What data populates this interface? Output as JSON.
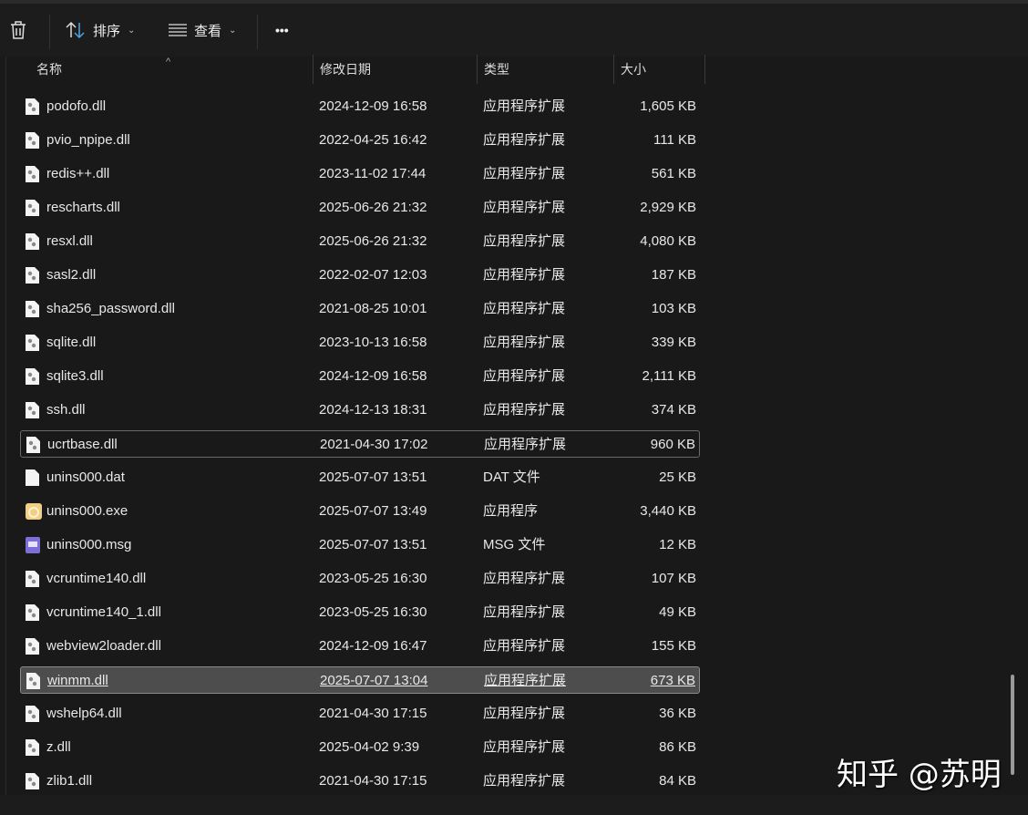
{
  "toolbar": {
    "sort_label": "排序",
    "view_label": "查看",
    "more_label": "•••"
  },
  "columns": {
    "name": "名称",
    "date": "修改日期",
    "type": "类型",
    "size": "大小"
  },
  "files": [
    {
      "name": "podofo.dll",
      "date": "2024-12-09 16:58",
      "type": "应用程序扩展",
      "size": "1,605 KB",
      "icon": "dll"
    },
    {
      "name": "pvio_npipe.dll",
      "date": "2022-04-25 16:42",
      "type": "应用程序扩展",
      "size": "111 KB",
      "icon": "dll"
    },
    {
      "name": "redis++.dll",
      "date": "2023-11-02 17:44",
      "type": "应用程序扩展",
      "size": "561 KB",
      "icon": "dll"
    },
    {
      "name": "rescharts.dll",
      "date": "2025-06-26 21:32",
      "type": "应用程序扩展",
      "size": "2,929 KB",
      "icon": "dll"
    },
    {
      "name": "resxl.dll",
      "date": "2025-06-26 21:32",
      "type": "应用程序扩展",
      "size": "4,080 KB",
      "icon": "dll"
    },
    {
      "name": "sasl2.dll",
      "date": "2022-02-07 12:03",
      "type": "应用程序扩展",
      "size": "187 KB",
      "icon": "dll"
    },
    {
      "name": "sha256_password.dll",
      "date": "2021-08-25 10:01",
      "type": "应用程序扩展",
      "size": "103 KB",
      "icon": "dll"
    },
    {
      "name": "sqlite.dll",
      "date": "2023-10-13 16:58",
      "type": "应用程序扩展",
      "size": "339 KB",
      "icon": "dll"
    },
    {
      "name": "sqlite3.dll",
      "date": "2024-12-09 16:58",
      "type": "应用程序扩展",
      "size": "2,111 KB",
      "icon": "dll"
    },
    {
      "name": "ssh.dll",
      "date": "2024-12-13 18:31",
      "type": "应用程序扩展",
      "size": "374 KB",
      "icon": "dll"
    },
    {
      "name": "ucrtbase.dll",
      "date": "2021-04-30 17:02",
      "type": "应用程序扩展",
      "size": "960 KB",
      "icon": "dll",
      "state": "focus"
    },
    {
      "name": "unins000.dat",
      "date": "2025-07-07 13:51",
      "type": "DAT 文件",
      "size": "25 KB",
      "icon": "dat"
    },
    {
      "name": "unins000.exe",
      "date": "2025-07-07 13:49",
      "type": "应用程序",
      "size": "3,440 KB",
      "icon": "exe"
    },
    {
      "name": "unins000.msg",
      "date": "2025-07-07 13:51",
      "type": "MSG 文件",
      "size": "12 KB",
      "icon": "msg"
    },
    {
      "name": "vcruntime140.dll",
      "date": "2023-05-25 16:30",
      "type": "应用程序扩展",
      "size": "107 KB",
      "icon": "dll"
    },
    {
      "name": "vcruntime140_1.dll",
      "date": "2023-05-25 16:30",
      "type": "应用程序扩展",
      "size": "49 KB",
      "icon": "dll"
    },
    {
      "name": "webview2loader.dll",
      "date": "2024-12-09 16:47",
      "type": "应用程序扩展",
      "size": "155 KB",
      "icon": "dll"
    },
    {
      "name": "winmm.dll",
      "date": "2025-07-07 13:04",
      "type": "应用程序扩展",
      "size": "673 KB",
      "icon": "dll",
      "state": "sel"
    },
    {
      "name": "wshelp64.dll",
      "date": "2021-04-30 17:15",
      "type": "应用程序扩展",
      "size": "36 KB",
      "icon": "dll"
    },
    {
      "name": "z.dll",
      "date": "2025-04-02 9:39",
      "type": "应用程序扩展",
      "size": "86 KB",
      "icon": "dll"
    },
    {
      "name": "zlib1.dll",
      "date": "2021-04-30 17:15",
      "type": "应用程序扩展",
      "size": "84 KB",
      "icon": "dll"
    }
  ],
  "watermark": "知乎 @苏明"
}
